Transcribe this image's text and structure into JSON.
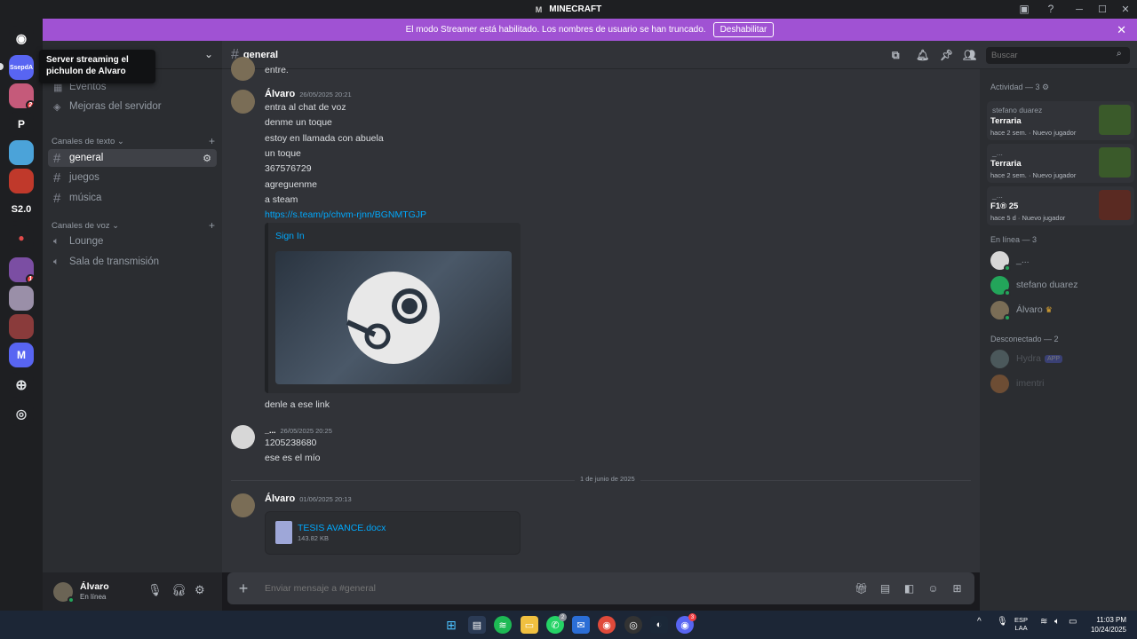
{
  "window": {
    "title": "MINECRAFT",
    "title_glyph": "M"
  },
  "banner": {
    "text": "El modo Streamer está habilitado. Los nombres de usuario se han truncado.",
    "button": "Deshabilitar"
  },
  "servers": [
    {
      "label": "SsepdA",
      "color": "#5865f2"
    },
    {
      "label": "",
      "color": "#c55a7a",
      "badge": "2"
    },
    {
      "label": "P",
      "color": "#1e1f22"
    },
    {
      "label": "",
      "color": "#4ba3d9"
    },
    {
      "label": "",
      "color": "#c0392b"
    },
    {
      "label": "S2.0",
      "color": "#1e1f22"
    },
    {
      "label": "",
      "color": "#1e1f22"
    },
    {
      "label": "",
      "color": "#7b4ea3",
      "badge": "1"
    },
    {
      "label": "",
      "color": "#9a8fa8"
    },
    {
      "label": "",
      "color": "#8a3b3b"
    },
    {
      "label": "M",
      "color": "#5865f2"
    }
  ],
  "tooltip": "Server streaming el pichulon de Alvaro",
  "sidebar": {
    "items": [
      {
        "label": "Eventos"
      },
      {
        "label": "Mejoras del servidor"
      }
    ],
    "text_category": "Canales de texto",
    "text_channels": [
      "general",
      "juegos",
      "música"
    ],
    "voice_category": "Canales de voz",
    "voice_channels": [
      "Lounge",
      "Sala de transmisión"
    ]
  },
  "user": {
    "name": "Álvaro",
    "status": "En línea"
  },
  "chat": {
    "channel": "general",
    "search_placeholder": "Buscar",
    "top_fragment": "entre.",
    "messages": [
      {
        "author": "Álvaro",
        "time": "26/05/2025 20:21",
        "lines": [
          "entra al chat de voz",
          "denme un toque",
          "estoy en llamada con abuela",
          "un toque",
          "367576729",
          "agreguenme",
          "a steam"
        ],
        "link": "https://s.team/p/chvm-rjnn/BGNMTGJP",
        "embed_title": "Sign In",
        "after": "denle a ese link"
      },
      {
        "author": "_...",
        "time": "26/05/2025 20:25",
        "lines": [
          "1205238680",
          "ese es el mío"
        ]
      }
    ],
    "divider": "1 de junio de 2025",
    "attachment_message": {
      "author": "Álvaro",
      "time": "01/06/2025 20:13",
      "file": "TESIS AVANCE.docx",
      "size": "143.82 KB"
    },
    "composer_placeholder": "Enviar mensaje a #general"
  },
  "right": {
    "activity_header": "Actividad — 3",
    "activities": [
      {
        "user": "stefano duarez",
        "game": "Terraria",
        "time": "hace 2 sem.",
        "tag": "Nuevo jugador"
      },
      {
        "user": "_...",
        "game": "Terraria",
        "time": "hace 2 sem.",
        "tag": "Nuevo jugador"
      },
      {
        "user": "_...",
        "game": "F1® 25",
        "time": "hace 5 d",
        "tag": "Nuevo jugador"
      }
    ],
    "online_header": "En línea — 3",
    "online": [
      "_...",
      "stefano duarez",
      "Álvaro"
    ],
    "offline_header": "Desconectado — 2",
    "offline": [
      "Hydra",
      "imentri"
    ],
    "app_tag": "APP"
  },
  "taskbar": {
    "lang_top": "ESP",
    "lang_bottom": "LAA",
    "time": "11:03 PM",
    "date": "10/24/2025"
  }
}
